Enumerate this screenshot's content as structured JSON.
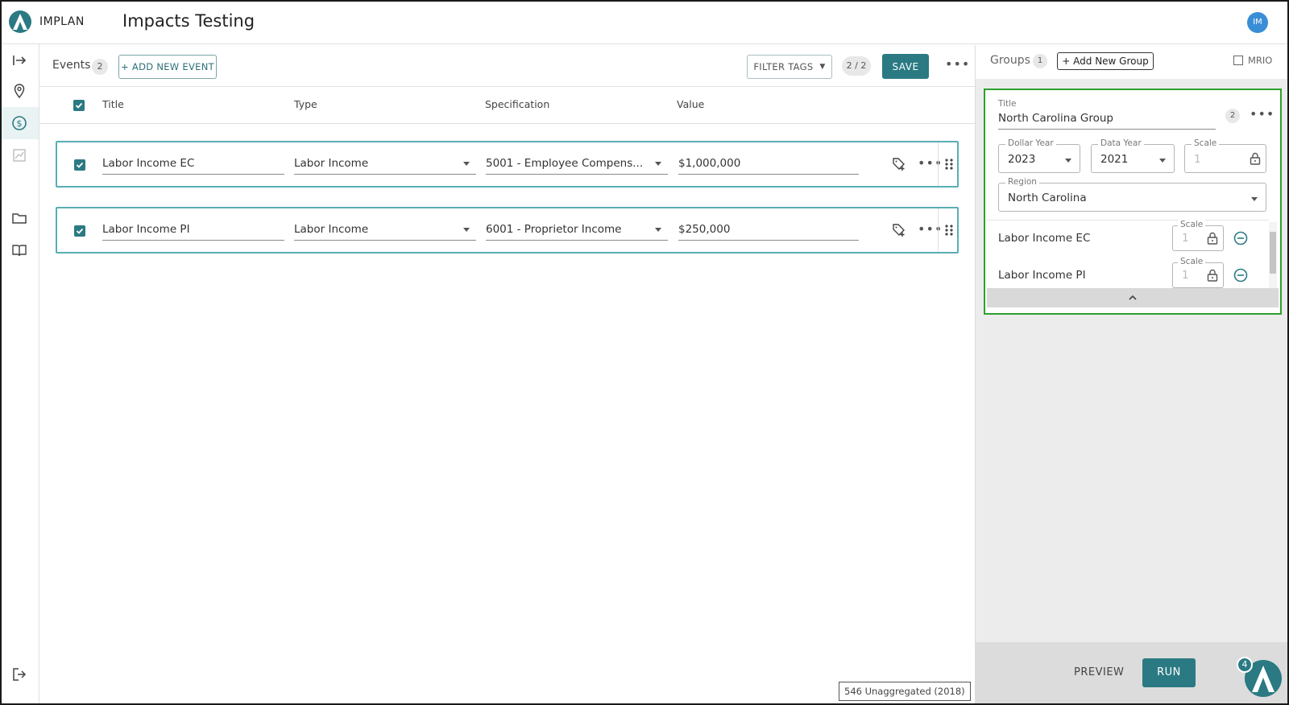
{
  "header": {
    "logo_text": "IMPLAN",
    "title": "Impacts Testing",
    "avatar_initials": "IM"
  },
  "leftnav": {
    "items": [
      {
        "icon": "collapse-arrow-icon"
      },
      {
        "icon": "location-pin-icon"
      },
      {
        "icon": "dollar-icon",
        "active": true
      },
      {
        "icon": "chart-icon"
      },
      {
        "icon": "folder-icon"
      },
      {
        "icon": "book-icon"
      },
      {
        "icon": "logout-icon"
      }
    ]
  },
  "events": {
    "label": "Events",
    "count": "2",
    "add_button": "+ ADD NEW EVENT",
    "filter_button": "FILTER TAGS",
    "page_indicator": "2 / 2",
    "save_button": "SAVE",
    "columns": {
      "title": "Title",
      "type": "Type",
      "specification": "Specification",
      "value": "Value"
    },
    "rows": [
      {
        "title": "Labor Income EC",
        "type": "Labor Income",
        "specification": "5001 - Employee Compens...",
        "value": "$1,000,000",
        "checked": true
      },
      {
        "title": "Labor Income PI",
        "type": "Labor Income",
        "specification": "6001 - Proprietor Income",
        "value": "$250,000",
        "checked": true
      }
    ]
  },
  "status": {
    "unaggregated": "546 Unaggregated (2018)"
  },
  "groups": {
    "label": "Groups",
    "count": "1",
    "add_button": "+ Add New Group",
    "mrio_label": "MRIO",
    "card": {
      "title_label": "Title",
      "title_value": "North Carolina Group",
      "event_count": "2",
      "dollar_year_label": "Dollar Year",
      "dollar_year": "2023",
      "data_year_label": "Data Year",
      "data_year": "2021",
      "scale_label": "Scale",
      "scale_value": "1",
      "region_label": "Region",
      "region_value": "North Carolina",
      "events": [
        {
          "name": "Labor Income EC",
          "scale_label": "Scale",
          "scale": "1"
        },
        {
          "name": "Labor Income PI",
          "scale_label": "Scale",
          "scale": "1"
        }
      ]
    },
    "preview_button": "PREVIEW",
    "run_button": "RUN",
    "notification_count": "4"
  },
  "colors": {
    "accent": "#2b7a83",
    "row_border": "#58aeb4",
    "group_highlight": "#2e9e2e"
  }
}
